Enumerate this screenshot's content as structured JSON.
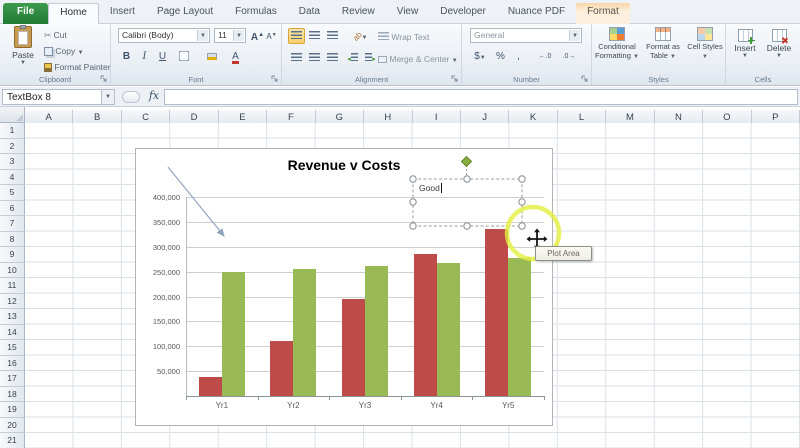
{
  "ribbon": {
    "tabs": [
      {
        "label": "File",
        "kind": "file"
      },
      {
        "label": "Home",
        "active": true
      },
      {
        "label": "Insert"
      },
      {
        "label": "Page Layout"
      },
      {
        "label": "Formulas"
      },
      {
        "label": "Data"
      },
      {
        "label": "Review"
      },
      {
        "label": "View"
      },
      {
        "label": "Developer"
      },
      {
        "label": "Nuance PDF"
      },
      {
        "label": "Format",
        "contextual": true
      }
    ],
    "clipboard": {
      "label": "Clipboard",
      "paste": "Paste",
      "cut": "Cut",
      "copy": "Copy",
      "format_painter": "Format Painter"
    },
    "font": {
      "label": "Font",
      "name": "Calibri (Body)",
      "size": "11"
    },
    "alignment": {
      "label": "Alignment",
      "wrap_text": "Wrap Text",
      "merge_center": "Merge & Center"
    },
    "number": {
      "label": "Number",
      "format": "General",
      "currency": "$",
      "percent": "%",
      "comma": ","
    },
    "styles": {
      "label": "Styles",
      "conditional": "Conditional Formatting",
      "format_table": "Format as Table",
      "cell_styles": "Cell Styles"
    },
    "cells": {
      "label": "Cells",
      "insert": "Insert",
      "delete": "Delete"
    }
  },
  "formula_bar": {
    "name_box": "TextBox 8",
    "fx_label": "fx",
    "value": ""
  },
  "sheet": {
    "columns": [
      "A",
      "B",
      "C",
      "D",
      "E",
      "F",
      "G",
      "H",
      "I",
      "J",
      "K",
      "L",
      "M",
      "N",
      "O",
      "P"
    ],
    "rows": [
      "1",
      "2",
      "3",
      "4",
      "5",
      "6",
      "7",
      "8",
      "9",
      "10",
      "11",
      "12",
      "13",
      "14",
      "15",
      "16",
      "17",
      "18",
      "19",
      "20",
      "21"
    ]
  },
  "chart_data": {
    "type": "bar",
    "title": "Revenue v Costs",
    "categories": [
      "Yr1",
      "Yr2",
      "Yr3",
      "Yr4",
      "Yr5"
    ],
    "series": [
      {
        "color": "#be4b48",
        "values": [
          38000,
          110000,
          195000,
          285000,
          335000
        ]
      },
      {
        "color": "#98b954",
        "values": [
          250000,
          255000,
          262000,
          268000,
          278000
        ]
      }
    ],
    "ylim": [
      0,
      400000
    ],
    "ytick_interval": 50000,
    "ytick_labels_top_to_bottom": [
      "400,000",
      "350,000",
      "300,000",
      "250,000",
      "200,000",
      "150,000",
      "100,000",
      "50,000"
    ],
    "grid": true,
    "legend": "none"
  },
  "annotations": {
    "textbox_text": "Good",
    "tooltip": "Plot Area"
  },
  "colors": {
    "bar_red": "#be4b48",
    "bar_green": "#98b954",
    "highlight_ring": "#e3ee3f",
    "file_tab": "#217a36"
  }
}
